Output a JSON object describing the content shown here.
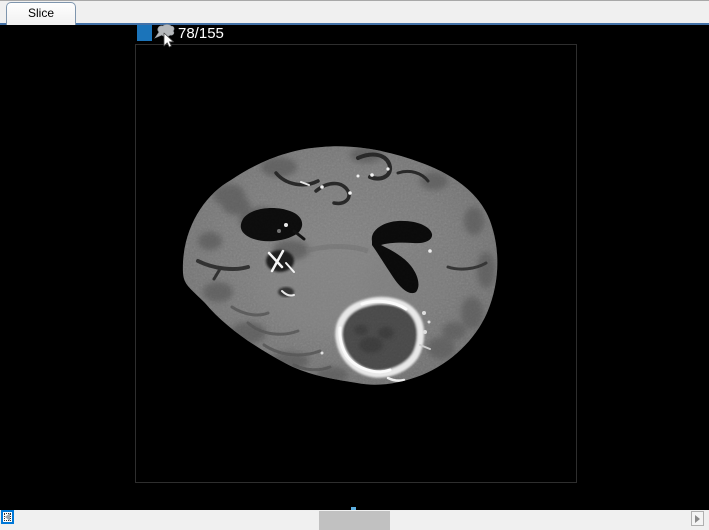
{
  "tab_bar": {
    "tabs": [
      {
        "label": "Slice",
        "selected": true
      }
    ]
  },
  "slice_view": {
    "counter_label": "78/155",
    "current_slice": 78,
    "total_slices": 155,
    "swatch_color": "#1b74ba",
    "icons": {
      "pin": "pin-icon",
      "cursor": "mouse-cursor-icon"
    }
  },
  "colors": {
    "viewport_bg": "#000000",
    "frame_border": "#2e2e2e",
    "tab_bar_bg": "#f0f0f0",
    "tab_pane_border": "#4472a8",
    "counter_text": "#ffffff",
    "slider_tick": "#5dafe0",
    "scrollbar_bg": "#f0f0f0",
    "scrollbar_thumb": "#c1c1c1",
    "focus_border": "#0078d7"
  }
}
